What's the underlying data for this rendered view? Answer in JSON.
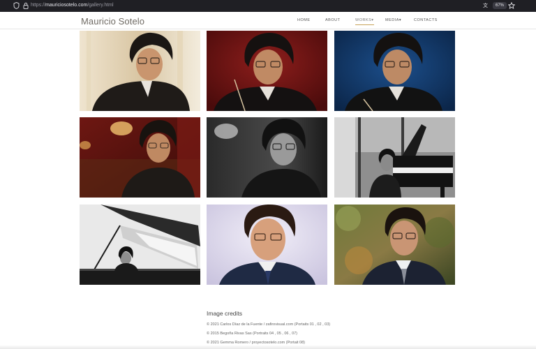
{
  "browser": {
    "url_prefix": "https://",
    "url_domain": "mauriciosotelo.com",
    "url_path": "/gallery.html",
    "zoom": "67%",
    "icons": {
      "shield": "shield-icon",
      "lock": "lock-icon",
      "translate": "translate-icon",
      "star": "star-icon"
    }
  },
  "site": {
    "logo": "Mauricio Sotelo",
    "nav": [
      {
        "label": "HOME"
      },
      {
        "label": "ABOUT"
      },
      {
        "label": "WORKS",
        "active": true,
        "dropdown": true
      },
      {
        "label": "MEDIA",
        "dropdown": true
      },
      {
        "label": "CONTACTS"
      }
    ],
    "accent_color": "#c7a35a"
  },
  "gallery": [
    {
      "alt": "Portrait 01",
      "background": "warm-light-curtain"
    },
    {
      "alt": "Portrait 02",
      "background": "red"
    },
    {
      "alt": "Portrait 03",
      "background": "blue"
    },
    {
      "alt": "Portrait 04",
      "background": "red-theatre"
    },
    {
      "alt": "Portrait 05",
      "background": "black-and-white"
    },
    {
      "alt": "Portrait 06",
      "background": "black-and-white-piano"
    },
    {
      "alt": "Portrait 07",
      "background": "black-and-white-grand-piano"
    },
    {
      "alt": "Portrait 08",
      "background": "lavender"
    },
    {
      "alt": "Portrait 09",
      "background": "garden"
    }
  ],
  "credits": {
    "title": "Image credits",
    "lines": [
      "© 2021 Carlos Díaz de la Fuente / zafirovisual.com (Portaits 01 , 02 , 03)",
      "© 2015 Begoña Rivas Sas (Portraits 04 , 05 , 06 , 07)",
      "© 2021 Gemma Romero / proyectosotelo.com (Portait 08)"
    ]
  }
}
